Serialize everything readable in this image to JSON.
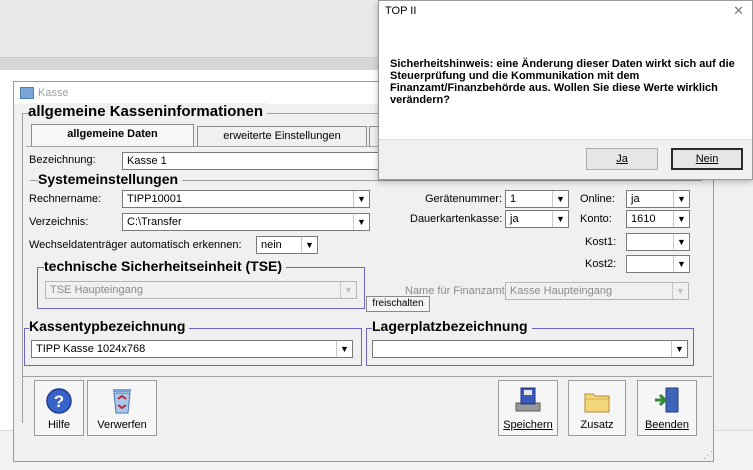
{
  "window": {
    "title": "Kasse"
  },
  "heading": "allgemeine Kasseninformationen",
  "tabs": [
    {
      "label": "allgemeine Daten"
    },
    {
      "label": "erweiterte Einstellungen"
    }
  ],
  "bezeichnung": {
    "label": "Bezeichnung:",
    "value": "Kasse 1"
  },
  "systemeinstellungen": {
    "title": "Systemeinstellungen",
    "rechnername_label": "Rechnername:",
    "rechnername_value": "TIPP10001",
    "verzeichnis_label": "Verzeichnis:",
    "verzeichnis_value": "C:\\Transfer",
    "wechsel_label": "Wechseldatenträger automatisch erkennen:",
    "wechsel_value": "nein",
    "geraetenummer_label": "Gerätenummer:",
    "geraetenummer_value": "1",
    "online_label": "Online:",
    "online_value": "ja",
    "dauerkarten_label": "Dauerkartenkasse:",
    "dauerkarten_value": "ja",
    "konto_label": "Konto:",
    "konto_value": "1610",
    "kost1_label": "Kost1:",
    "kost1_value": "",
    "kost2_label": "Kost2:",
    "kost2_value": ""
  },
  "tse": {
    "title": "technische Sicherheitseinheit (TSE)",
    "value": "TSE Haupteingang",
    "freischalten_label": "freischalten",
    "finanzamt_label": "Name für Finanzamt:",
    "finanzamt_value": "Kasse Haupteingang"
  },
  "kassentyp": {
    "title": "Kassentypbezeichnung",
    "value": "TIPP Kasse 1024x768"
  },
  "lagerplatz": {
    "title": "Lagerplatzbezeichnung",
    "value": ""
  },
  "toolbar": {
    "hilfe": "Hilfe",
    "verwerfen": "Verwerfen",
    "speichern": "Speichern",
    "zusatz": "Zusatz",
    "beenden": "Beenden"
  },
  "dialog": {
    "title": "TOP II",
    "message": "Sicherheitshinweis: eine Änderung dieser Daten wirkt sich auf die Steuerprüfung und die Kommunikation mit dem Finanzamt/Finanzbehörde aus. Wollen Sie diese Werte wirklich verändern?",
    "ja": "Ja",
    "nein": "Nein",
    "close_glyph": "✕"
  }
}
